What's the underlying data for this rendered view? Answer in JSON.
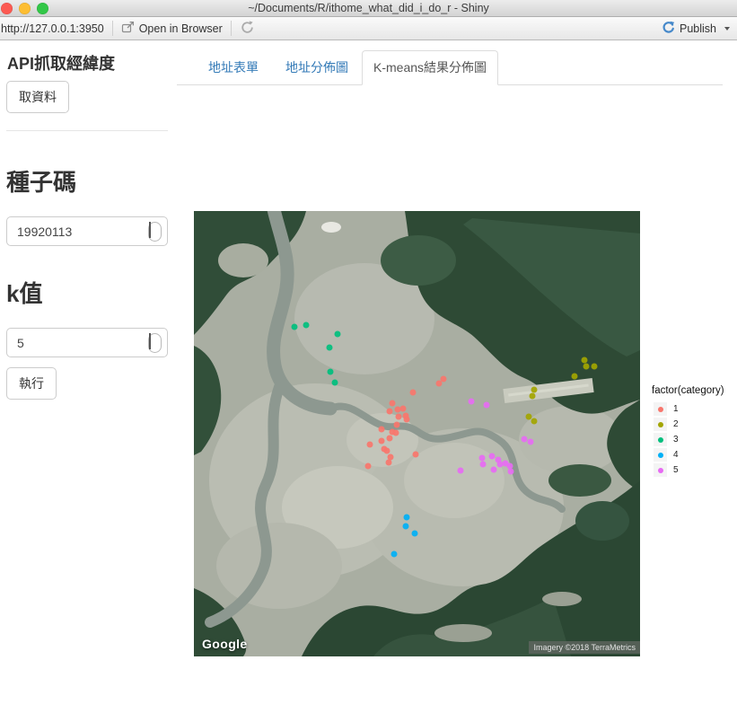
{
  "window": {
    "title": "~/Documents/R/ithome_what_did_i_do_r - Shiny",
    "traffic_light_colors": {
      "close": "#fc5a52",
      "minimize": "#fdbe33",
      "zoom": "#33c748"
    }
  },
  "toolbar": {
    "url": "http://127.0.0.1:3950",
    "open_in_browser": "Open in Browser",
    "publish": "Publish"
  },
  "sidebar": {
    "api_heading": "API抓取經緯度",
    "fetch_button": "取資料",
    "seed_heading": "種子碼",
    "seed_value": "19920113",
    "k_heading": "k值",
    "k_value": "5",
    "run_button": "執行"
  },
  "tabs": {
    "items": [
      {
        "label": "地址表單",
        "active": false
      },
      {
        "label": "地址分佈圖",
        "active": false
      },
      {
        "label": "K-means結果分佈圖",
        "active": true
      }
    ]
  },
  "plot": {
    "legend_title": "factor(category)",
    "legend_items": [
      {
        "label": "1",
        "color": "#F8766D"
      },
      {
        "label": "2",
        "color": "#A3A500"
      },
      {
        "label": "3",
        "color": "#00BF7D"
      },
      {
        "label": "4",
        "color": "#00B0F6"
      },
      {
        "label": "5",
        "color": "#E76BF3"
      }
    ],
    "google_logo": "Google",
    "attribution": "Imagery ©2018 TerraMetrics"
  },
  "chart_data": {
    "type": "scatter",
    "legend_title": "factor(category)",
    "series_labels": [
      "1",
      "2",
      "3",
      "4",
      "5"
    ],
    "category_colors": {
      "1": "#F8766D",
      "2": "#A3A500",
      "3": "#00BF7D",
      "4": "#00B0F6",
      "5": "#E76BF3"
    },
    "point_counts": {
      "1": 23,
      "2": 8,
      "3": 6,
      "4": 4,
      "5": 14
    },
    "coord_units": "percent_of_map_panel",
    "points": [
      {
        "x": 22.5,
        "y": 26.0,
        "c": "3"
      },
      {
        "x": 25.2,
        "y": 25.6,
        "c": "3"
      },
      {
        "x": 32.2,
        "y": 27.6,
        "c": "3"
      },
      {
        "x": 30.4,
        "y": 30.6,
        "c": "3"
      },
      {
        "x": 30.6,
        "y": 36.1,
        "c": "3"
      },
      {
        "x": 31.6,
        "y": 38.5,
        "c": "3"
      },
      {
        "x": 54.9,
        "y": 38.7,
        "c": "1"
      },
      {
        "x": 55.9,
        "y": 37.7,
        "c": "1"
      },
      {
        "x": 49.1,
        "y": 40.7,
        "c": "1"
      },
      {
        "x": 44.5,
        "y": 43.1,
        "c": "1"
      },
      {
        "x": 43.9,
        "y": 45.0,
        "c": "1"
      },
      {
        "x": 45.7,
        "y": 44.6,
        "c": "1"
      },
      {
        "x": 46.9,
        "y": 44.4,
        "c": "1"
      },
      {
        "x": 45.9,
        "y": 46.2,
        "c": "1"
      },
      {
        "x": 47.5,
        "y": 46.0,
        "c": "1"
      },
      {
        "x": 47.7,
        "y": 46.8,
        "c": "1"
      },
      {
        "x": 45.5,
        "y": 48.0,
        "c": "1"
      },
      {
        "x": 42.1,
        "y": 49.0,
        "c": "1"
      },
      {
        "x": 44.5,
        "y": 49.6,
        "c": "1"
      },
      {
        "x": 45.3,
        "y": 49.8,
        "c": "1"
      },
      {
        "x": 39.4,
        "y": 52.4,
        "c": "1"
      },
      {
        "x": 42.1,
        "y": 51.6,
        "c": "1"
      },
      {
        "x": 43.9,
        "y": 51.0,
        "c": "1"
      },
      {
        "x": 42.7,
        "y": 53.4,
        "c": "1"
      },
      {
        "x": 43.3,
        "y": 53.8,
        "c": "1"
      },
      {
        "x": 44.1,
        "y": 55.2,
        "c": "1"
      },
      {
        "x": 49.7,
        "y": 54.6,
        "c": "1"
      },
      {
        "x": 43.7,
        "y": 56.5,
        "c": "1"
      },
      {
        "x": 39.0,
        "y": 57.3,
        "c": "1"
      },
      {
        "x": 87.5,
        "y": 33.5,
        "c": "2"
      },
      {
        "x": 87.9,
        "y": 34.9,
        "c": "2"
      },
      {
        "x": 89.7,
        "y": 34.9,
        "c": "2"
      },
      {
        "x": 85.3,
        "y": 37.1,
        "c": "2"
      },
      {
        "x": 76.3,
        "y": 40.1,
        "c": "2"
      },
      {
        "x": 75.9,
        "y": 41.5,
        "c": "2"
      },
      {
        "x": 75.1,
        "y": 46.2,
        "c": "2"
      },
      {
        "x": 76.3,
        "y": 47.2,
        "c": "2"
      },
      {
        "x": 62.2,
        "y": 42.7,
        "c": "5"
      },
      {
        "x": 65.6,
        "y": 43.5,
        "c": "5"
      },
      {
        "x": 74.0,
        "y": 51.2,
        "c": "5"
      },
      {
        "x": 75.5,
        "y": 51.8,
        "c": "5"
      },
      {
        "x": 64.6,
        "y": 55.4,
        "c": "5"
      },
      {
        "x": 66.8,
        "y": 55.0,
        "c": "5"
      },
      {
        "x": 64.8,
        "y": 56.9,
        "c": "5"
      },
      {
        "x": 68.2,
        "y": 55.8,
        "c": "5"
      },
      {
        "x": 68.6,
        "y": 56.9,
        "c": "5"
      },
      {
        "x": 69.8,
        "y": 56.7,
        "c": "5"
      },
      {
        "x": 67.2,
        "y": 58.1,
        "c": "5"
      },
      {
        "x": 70.8,
        "y": 57.3,
        "c": "5"
      },
      {
        "x": 71.0,
        "y": 58.5,
        "c": "5"
      },
      {
        "x": 59.8,
        "y": 58.3,
        "c": "5"
      },
      {
        "x": 47.7,
        "y": 68.8,
        "c": "4"
      },
      {
        "x": 47.5,
        "y": 70.8,
        "c": "4"
      },
      {
        "x": 49.5,
        "y": 72.4,
        "c": "4"
      },
      {
        "x": 44.9,
        "y": 77.0,
        "c": "4"
      }
    ]
  }
}
